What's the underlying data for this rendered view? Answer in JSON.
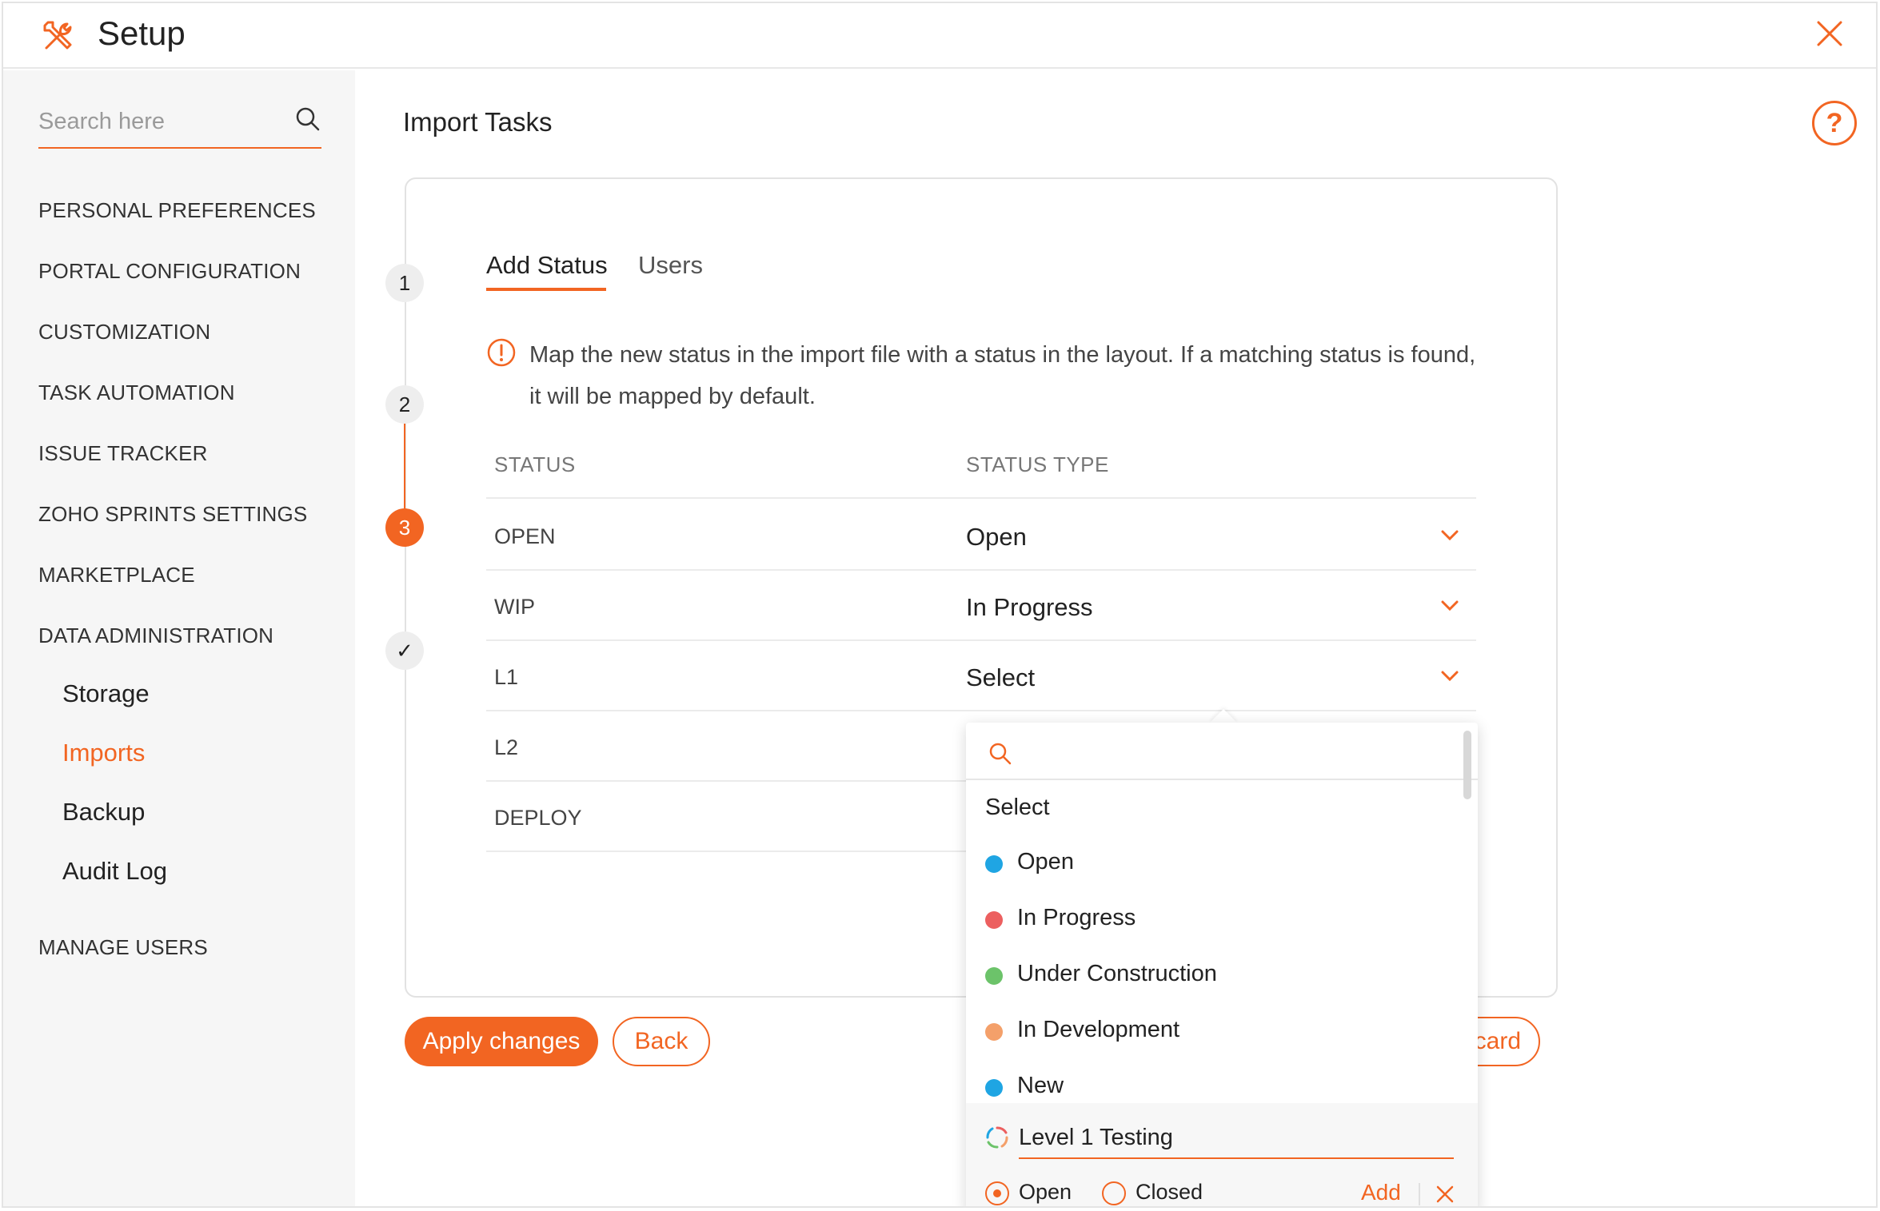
{
  "header": {
    "title": "Setup"
  },
  "sidebar": {
    "search_placeholder": "Search here",
    "items": [
      "PERSONAL PREFERENCES",
      "PORTAL CONFIGURATION",
      "CUSTOMIZATION",
      "TASK AUTOMATION",
      "ISSUE TRACKER",
      "ZOHO SPRINTS SETTINGS",
      "MARKETPLACE",
      "DATA ADMINISTRATION"
    ],
    "sub_items": [
      "Storage",
      "Imports",
      "Backup",
      "Audit Log"
    ],
    "active_sub": "Imports",
    "bottom_item": "MANAGE USERS"
  },
  "main": {
    "page_title": "Import Tasks",
    "help_label": "?",
    "steps": [
      "1",
      "2",
      "3",
      "✓"
    ],
    "tabs": [
      "Add Status",
      "Users"
    ],
    "info_text": "Map the new status in the import file with a status in the layout. If a matching status is found, it will be mapped by default.",
    "columns": [
      "STATUS",
      "STATUS TYPE"
    ],
    "rows": [
      {
        "status": "OPEN",
        "type": "Open"
      },
      {
        "status": "WIP",
        "type": "In Progress"
      },
      {
        "status": "L1",
        "type": "Select"
      },
      {
        "status": "L2",
        "type": ""
      },
      {
        "status": "DEPLOY",
        "type": ""
      }
    ],
    "buttons": {
      "apply": "Apply changes",
      "back": "Back",
      "discard_partial": "card"
    }
  },
  "dropdown": {
    "first_option": "Select",
    "options": [
      {
        "label": "Open",
        "color": "#1fa5e3"
      },
      {
        "label": "In Progress",
        "color": "#ec5f5f"
      },
      {
        "label": "Under Construction",
        "color": "#6cc36a"
      },
      {
        "label": "In Development",
        "color": "#f4a06a"
      },
      {
        "label": "New",
        "color": "#1fa5e3"
      }
    ],
    "new_status_value": "Level 1 Testing",
    "radio_open": "Open",
    "radio_closed": "Closed",
    "add_label": "Add"
  },
  "colors": {
    "accent": "#f26522"
  }
}
